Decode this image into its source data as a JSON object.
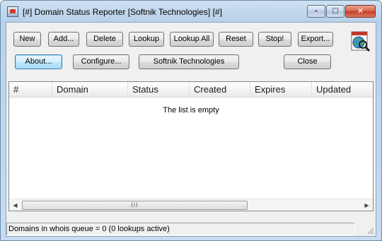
{
  "window": {
    "title": "[#] Domain Status Reporter [Softnik Technologies] [#]",
    "controls": {
      "minimize": "–",
      "maximize": "□",
      "close": "✕"
    }
  },
  "toolbar": {
    "row1": [
      "New",
      "Add...",
      "Delete",
      "Lookup",
      "Lookup All",
      "Reset",
      "Stop!",
      "Export..."
    ],
    "row2": {
      "about": "About...",
      "configure": "Configure...",
      "company": "Softnik Technologies",
      "close": "Close"
    }
  },
  "list": {
    "columns": [
      "#",
      "Domain",
      "Status",
      "Created",
      "Expires",
      "Updated"
    ],
    "empty_message": "The list is empty",
    "scroll_grip": "III"
  },
  "status": {
    "text": "Domains in whois queue = 0 (0 lookups active)"
  },
  "icons": {
    "logo": "globe-magnifier-icon",
    "app": "app-icon"
  },
  "colors": {
    "title_bar": "#b9d1ea",
    "close_button": "#c43c22",
    "focus_button": "#3c7fb1"
  }
}
